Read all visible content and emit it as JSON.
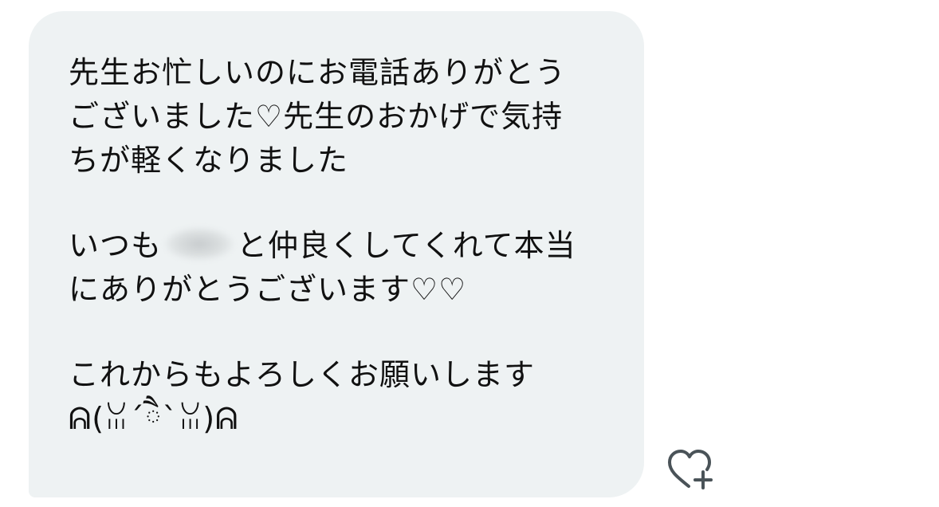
{
  "message": {
    "lines": [
      "先生お忙しいのにお電話ありがとう",
      "ございました♡先生のおかげで気持",
      "ちが軽くなりました"
    ],
    "para2_line1_before": "いつも",
    "para2_line1_after": "と仲良くしてくれて本当",
    "para2_line2": "にありがとうございます♡♡",
    "para3_line1": "これからもよろしくお願いします",
    "para3_line2": "ᕱ(ꈍ´ཻ`ꈍ)ᕱ"
  },
  "icons": {
    "react": "heart-plus-icon"
  },
  "colors": {
    "bubble": "#eef2f3",
    "text": "#111111",
    "icon": "#4a5358"
  }
}
